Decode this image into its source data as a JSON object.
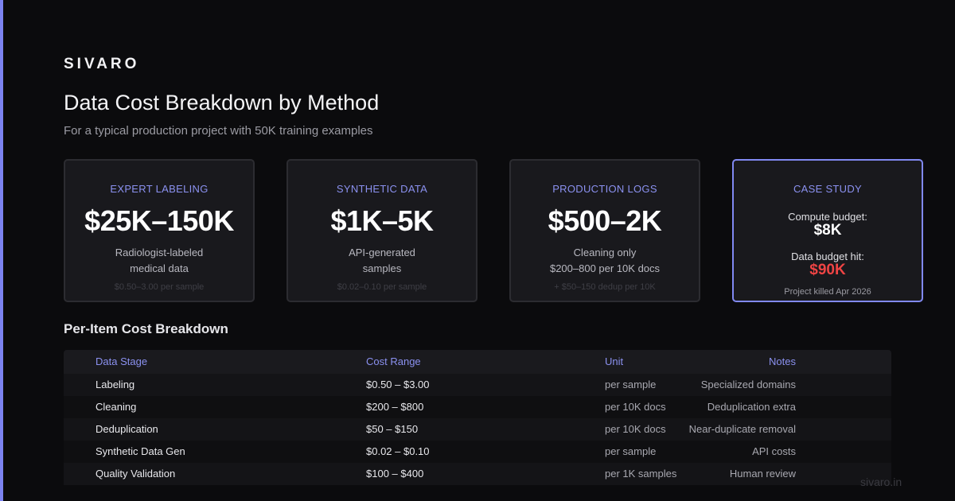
{
  "brand": "SIVARO",
  "title": "Data Cost Breakdown by Method",
  "subtitle": "For a typical production project with 50K training examples",
  "cards": [
    {
      "label": "EXPERT LABELING",
      "value": "$25K–150K",
      "desc1": "Radiologist-labeled",
      "desc2": "medical data",
      "foot": "$0.50–3.00 per sample"
    },
    {
      "label": "SYNTHETIC DATA",
      "value": "$1K–5K",
      "desc1": "API-generated",
      "desc2": "samples",
      "foot": "$0.02–0.10 per sample"
    },
    {
      "label": "PRODUCTION LOGS",
      "value": "$500–2K",
      "desc1": "Cleaning only",
      "desc2": "$200–800 per 10K docs",
      "foot": "+ $50–150 dedup per 10K"
    }
  ],
  "case_study": {
    "label": "CASE STUDY",
    "compute_label": "Compute budget:",
    "compute_value": "$8K",
    "data_label": "Data budget hit:",
    "data_value": "$90K",
    "foot": "Project killed Apr 2026"
  },
  "section_title": "Per-Item Cost Breakdown",
  "table": {
    "headers": [
      "Data Stage",
      "Cost Range",
      "Unit",
      "Notes"
    ],
    "rows": [
      [
        "Labeling",
        "$0.50 – $3.00",
        "per sample",
        "Specialized domains"
      ],
      [
        "Cleaning",
        "$200 – $800",
        "per 10K docs",
        "Deduplication extra"
      ],
      [
        "Deduplication",
        "$50 – $150",
        "per 10K docs",
        "Near-duplicate removal"
      ],
      [
        "Synthetic Data Gen",
        "$0.02 – $0.10",
        "per sample",
        "API costs"
      ],
      [
        "Quality Validation",
        "$100 – $400",
        "per 1K samples",
        "Human review"
      ]
    ]
  },
  "footer_url": "sivaro.in",
  "colors": {
    "accent": "#8189f2",
    "danger": "#ef4444",
    "background": "#0b0b0d"
  }
}
